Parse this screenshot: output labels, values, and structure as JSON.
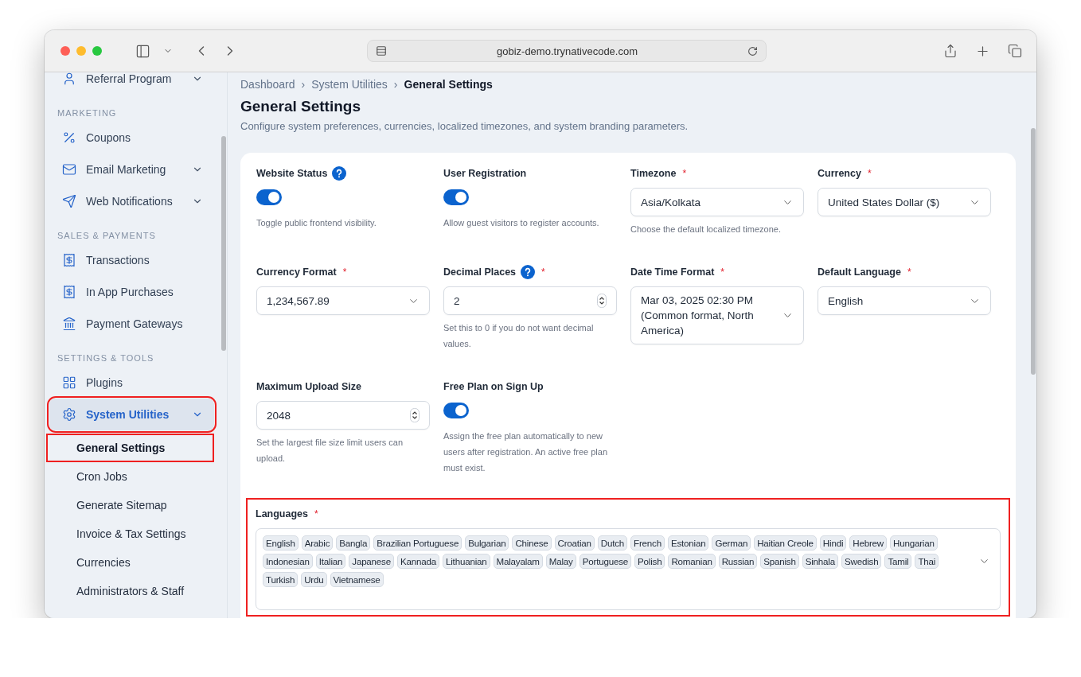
{
  "browser": {
    "url": "gobiz-demo.trynativecode.com"
  },
  "sidebar": {
    "groups": [
      {
        "items": [
          {
            "label": "Referral Program",
            "expandable": true,
            "selected": false,
            "highlighted": false
          }
        ]
      },
      {
        "heading": "MARKETING",
        "items": [
          {
            "label": "Coupons",
            "expandable": false,
            "selected": false,
            "highlighted": false
          },
          {
            "label": "Email Marketing",
            "expandable": true,
            "selected": false,
            "highlighted": false
          },
          {
            "label": "Web Notifications",
            "expandable": true,
            "selected": false,
            "highlighted": false
          }
        ]
      },
      {
        "heading": "SALES & PAYMENTS",
        "items": [
          {
            "label": "Transactions",
            "expandable": false,
            "selected": false,
            "highlighted": false
          },
          {
            "label": "In App Purchases",
            "expandable": false,
            "selected": false,
            "highlighted": false
          },
          {
            "label": "Payment Gateways",
            "expandable": false,
            "selected": false,
            "highlighted": false
          }
        ]
      },
      {
        "heading": "SETTINGS & TOOLS",
        "items": [
          {
            "label": "Plugins",
            "expandable": false,
            "selected": false,
            "highlighted": false
          },
          {
            "label": "System Utilities",
            "expandable": true,
            "selected": true,
            "highlighted": true,
            "children": [
              {
                "label": "General Settings",
                "selected": true,
                "highlighted": true
              },
              {
                "label": "Cron Jobs",
                "selected": false,
                "highlighted": false
              },
              {
                "label": "Generate Sitemap",
                "selected": false,
                "highlighted": false
              },
              {
                "label": "Invoice & Tax Settings",
                "selected": false,
                "highlighted": false
              },
              {
                "label": "Currencies",
                "selected": false,
                "highlighted": false
              },
              {
                "label": "Administrators & Staff",
                "selected": false,
                "highlighted": false
              }
            ]
          }
        ]
      }
    ]
  },
  "breadcrumb": [
    "Dashboard",
    "System Utilities",
    "General Settings"
  ],
  "breadcrumb_separator": "›",
  "title": "General Settings",
  "description": "Configure system preferences, currencies, localized timezones, and system branding parameters.",
  "fields": [
    {
      "kind": "toggle",
      "label": "Website Status",
      "help": true,
      "on": true,
      "hint": "Toggle public frontend visibility."
    },
    {
      "kind": "toggle",
      "label": "User Registration",
      "on": true,
      "hint": "Allow guest visitors to register accounts."
    },
    {
      "kind": "select",
      "label": "Timezone",
      "required_mark": "*",
      "value": "Asia/Kolkata",
      "hint": "Choose the default localized timezone."
    },
    {
      "kind": "select",
      "label": "Currency",
      "required_mark": "*",
      "value": "United States Dollar ($)"
    },
    {
      "kind": "select",
      "label": "Currency Format",
      "required_mark": "*",
      "value": "1,234,567.89"
    },
    {
      "kind": "number",
      "label": "Decimal Places",
      "required_mark": "*",
      "help": true,
      "value": "2",
      "hint": "Set this to 0 if you do not want decimal values."
    },
    {
      "kind": "select",
      "label": "Date Time Format",
      "required_mark": "*",
      "value": "Mar 03, 2025 02:30 PM (Common format, North America)"
    },
    {
      "kind": "select",
      "label": "Default Language",
      "required_mark": "*",
      "value": "English"
    },
    {
      "kind": "number",
      "label": "Maximum Upload Size",
      "value": "2048",
      "hint": "Set the largest file size limit users can upload."
    },
    {
      "kind": "toggle",
      "label": "Free Plan on Sign Up",
      "on": true,
      "hint": "Assign the free plan automatically to new users after registration. An active free plan must exist."
    }
  ],
  "languages": {
    "label": "Languages",
    "required_mark": "*",
    "highlighted": true,
    "tags": [
      "English",
      "Arabic",
      "Bangla",
      "Brazilian Portuguese",
      "Bulgarian",
      "Chinese",
      "Croatian",
      "Dutch",
      "French",
      "Estonian",
      "German",
      "Haitian Creole",
      "Hindi",
      "Hebrew",
      "Hungarian",
      "Indonesian",
      "Italian",
      "Japanese",
      "Kannada",
      "Lithuanian",
      "Malayalam",
      "Malay",
      "Portuguese",
      "Polish",
      "Romanian",
      "Russian",
      "Spanish",
      "Sinhala",
      "Swedish",
      "Tamil",
      "Thai",
      "Turkish",
      "Urdu",
      "Vietnamese"
    ]
  }
}
